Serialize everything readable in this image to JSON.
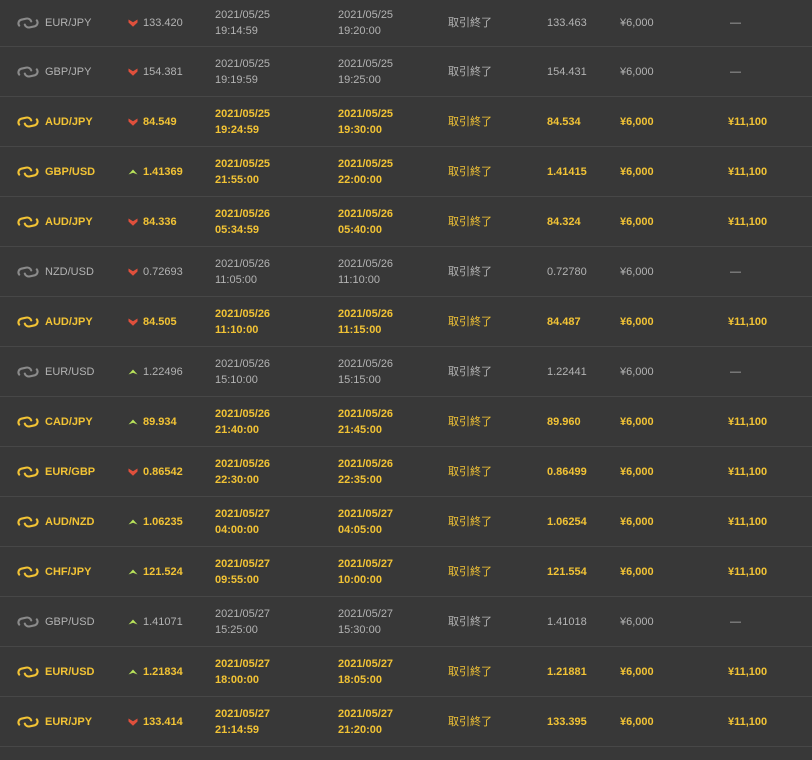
{
  "colors": {
    "background": "#383838",
    "win_text": "#f2c335",
    "loss_text": "#b3b3b3",
    "arrow_up": "#b9e35a",
    "arrow_down": "#e0503c",
    "icon_win": "#f2c335",
    "icon_loss": "#8a8a8a"
  },
  "trades": [
    {
      "pair": "EUR/JPY",
      "direction": "down",
      "entry_price": "133.420",
      "start_date": "2021/05/25",
      "start_time": "19:14:59",
      "end_date": "2021/05/25",
      "end_time": "19:20:00",
      "status": "取引終了",
      "close_price": "133.463",
      "amount": "¥6,000",
      "payout": "—",
      "result": "lost"
    },
    {
      "pair": "GBP/JPY",
      "direction": "down",
      "entry_price": "154.381",
      "start_date": "2021/05/25",
      "start_time": "19:19:59",
      "end_date": "2021/05/25",
      "end_time": "19:25:00",
      "status": "取引終了",
      "close_price": "154.431",
      "amount": "¥6,000",
      "payout": "—",
      "result": "lost"
    },
    {
      "pair": "AUD/JPY",
      "direction": "down",
      "entry_price": "84.549",
      "start_date": "2021/05/25",
      "start_time": "19:24:59",
      "end_date": "2021/05/25",
      "end_time": "19:30:00",
      "status": "取引終了",
      "close_price": "84.534",
      "amount": "¥6,000",
      "payout": "¥11,100",
      "result": "won"
    },
    {
      "pair": "GBP/USD",
      "direction": "up",
      "entry_price": "1.41369",
      "start_date": "2021/05/25",
      "start_time": "21:55:00",
      "end_date": "2021/05/25",
      "end_time": "22:00:00",
      "status": "取引終了",
      "close_price": "1.41415",
      "amount": "¥6,000",
      "payout": "¥11,100",
      "result": "won"
    },
    {
      "pair": "AUD/JPY",
      "direction": "down",
      "entry_price": "84.336",
      "start_date": "2021/05/26",
      "start_time": "05:34:59",
      "end_date": "2021/05/26",
      "end_time": "05:40:00",
      "status": "取引終了",
      "close_price": "84.324",
      "amount": "¥6,000",
      "payout": "¥11,100",
      "result": "won"
    },
    {
      "pair": "NZD/USD",
      "direction": "down",
      "entry_price": "0.72693",
      "start_date": "2021/05/26",
      "start_time": "11:05:00",
      "end_date": "2021/05/26",
      "end_time": "11:10:00",
      "status": "取引終了",
      "close_price": "0.72780",
      "amount": "¥6,000",
      "payout": "—",
      "result": "lost"
    },
    {
      "pair": "AUD/JPY",
      "direction": "down",
      "entry_price": "84.505",
      "start_date": "2021/05/26",
      "start_time": "11:10:00",
      "end_date": "2021/05/26",
      "end_time": "11:15:00",
      "status": "取引終了",
      "close_price": "84.487",
      "amount": "¥6,000",
      "payout": "¥11,100",
      "result": "won"
    },
    {
      "pair": "EUR/USD",
      "direction": "up",
      "entry_price": "1.22496",
      "start_date": "2021/05/26",
      "start_time": "15:10:00",
      "end_date": "2021/05/26",
      "end_time": "15:15:00",
      "status": "取引終了",
      "close_price": "1.22441",
      "amount": "¥6,000",
      "payout": "—",
      "result": "lost"
    },
    {
      "pair": "CAD/JPY",
      "direction": "up",
      "entry_price": "89.934",
      "start_date": "2021/05/26",
      "start_time": "21:40:00",
      "end_date": "2021/05/26",
      "end_time": "21:45:00",
      "status": "取引終了",
      "close_price": "89.960",
      "amount": "¥6,000",
      "payout": "¥11,100",
      "result": "won"
    },
    {
      "pair": "EUR/GBP",
      "direction": "down",
      "entry_price": "0.86542",
      "start_date": "2021/05/26",
      "start_time": "22:30:00",
      "end_date": "2021/05/26",
      "end_time": "22:35:00",
      "status": "取引終了",
      "close_price": "0.86499",
      "amount": "¥6,000",
      "payout": "¥11,100",
      "result": "won"
    },
    {
      "pair": "AUD/NZD",
      "direction": "up",
      "entry_price": "1.06235",
      "start_date": "2021/05/27",
      "start_time": "04:00:00",
      "end_date": "2021/05/27",
      "end_time": "04:05:00",
      "status": "取引終了",
      "close_price": "1.06254",
      "amount": "¥6,000",
      "payout": "¥11,100",
      "result": "won"
    },
    {
      "pair": "CHF/JPY",
      "direction": "up",
      "entry_price": "121.524",
      "start_date": "2021/05/27",
      "start_time": "09:55:00",
      "end_date": "2021/05/27",
      "end_time": "10:00:00",
      "status": "取引終了",
      "close_price": "121.554",
      "amount": "¥6,000",
      "payout": "¥11,100",
      "result": "won"
    },
    {
      "pair": "GBP/USD",
      "direction": "up",
      "entry_price": "1.41071",
      "start_date": "2021/05/27",
      "start_time": "15:25:00",
      "end_date": "2021/05/27",
      "end_time": "15:30:00",
      "status": "取引終了",
      "close_price": "1.41018",
      "amount": "¥6,000",
      "payout": "—",
      "result": "lost"
    },
    {
      "pair": "EUR/USD",
      "direction": "up",
      "entry_price": "1.21834",
      "start_date": "2021/05/27",
      "start_time": "18:00:00",
      "end_date": "2021/05/27",
      "end_time": "18:05:00",
      "status": "取引終了",
      "close_price": "1.21881",
      "amount": "¥6,000",
      "payout": "¥11,100",
      "result": "won"
    },
    {
      "pair": "EUR/JPY",
      "direction": "down",
      "entry_price": "133.414",
      "start_date": "2021/05/27",
      "start_time": "21:14:59",
      "end_date": "2021/05/27",
      "end_time": "21:20:00",
      "status": "取引終了",
      "close_price": "133.395",
      "amount": "¥6,000",
      "payout": "¥11,100",
      "result": "won"
    }
  ]
}
